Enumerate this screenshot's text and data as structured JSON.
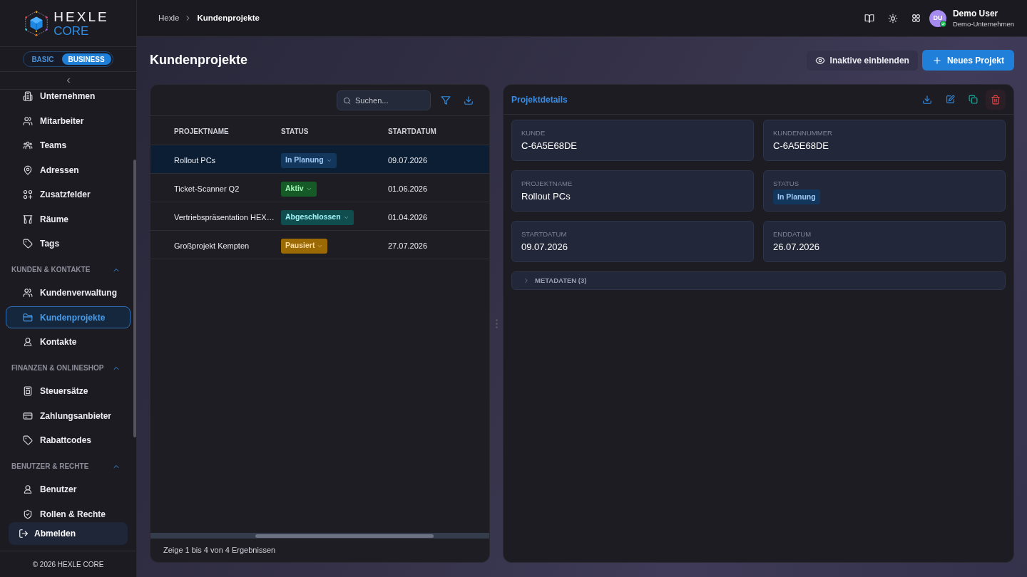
{
  "sidebar": {
    "logo": {
      "name": "HEXLE",
      "edition": "CORE"
    },
    "plans": [
      {
        "label": "BASIC",
        "selected": false
      },
      {
        "label": "BUSINESS",
        "selected": true
      }
    ],
    "groups": [
      {
        "items": [
          {
            "label": "Unternehmen",
            "selected": false
          },
          {
            "label": "Mitarbeiter",
            "selected": false
          },
          {
            "label": "Teams",
            "selected": false
          },
          {
            "label": "Adressen",
            "selected": false
          },
          {
            "label": "Zusatzfelder",
            "selected": false
          },
          {
            "label": "Räume",
            "selected": false
          },
          {
            "label": "Tags",
            "selected": false
          }
        ]
      },
      {
        "title": "KUNDEN & KONTAKTE",
        "expanded": true,
        "items": [
          {
            "label": "Kundenverwaltung",
            "selected": false
          },
          {
            "label": "Kundenprojekte",
            "selected": true
          },
          {
            "label": "Kontakte",
            "selected": false
          }
        ]
      },
      {
        "title": "FINANZEN & ONLINESHOP",
        "expanded": true,
        "items": [
          {
            "label": "Steuersätze",
            "selected": false
          },
          {
            "label": "Zahlungsanbieter",
            "selected": false
          },
          {
            "label": "Rabattcodes",
            "selected": false
          }
        ]
      },
      {
        "title": "BENUTZER & RECHTE",
        "expanded": true,
        "items": [
          {
            "label": "Benutzer",
            "selected": false
          },
          {
            "label": "Rollen & Rechte",
            "selected": false
          }
        ]
      }
    ],
    "logout": "Abmelden",
    "footer": "© 2026 HEXLE CORE"
  },
  "topbar": {
    "breadcrumb": [
      "Hexle",
      "Kundenprojekte"
    ],
    "user": {
      "initials": "DU",
      "name": "Demo User",
      "company": "Demo-Unternehmen"
    }
  },
  "page": {
    "title": "Kundenprojekte",
    "actions": [
      {
        "label": "Inaktive einblenden",
        "kind": "secondary"
      },
      {
        "label": "Neues Projekt",
        "kind": "primary"
      }
    ]
  },
  "table": {
    "search": {
      "placeholder": "Suchen..."
    },
    "columns": [
      "PROJEKTNAME",
      "STATUS",
      "STARTDATUM"
    ],
    "rows": [
      {
        "name": "Rollout PCs",
        "status": "In Planung",
        "color": "#12365c",
        "start": "09.07.2026",
        "selected": true
      },
      {
        "name": "Ticket-Scanner Q2",
        "status": "Aktiv",
        "color": "#165a27",
        "start": "01.06.2026",
        "selected": false
      },
      {
        "name": "Vertriebspräsentation HEX…",
        "status": "Abgeschlossen",
        "color": "#0f4d4f",
        "start": "01.04.2026",
        "selected": false
      },
      {
        "name": "Großprojekt Kempten",
        "status": "Pausiert",
        "color": "#9c6a04",
        "start": "27.07.2026",
        "selected": false
      }
    ],
    "footer": "Zeige 1 bis 4 von 4 Ergebnissen"
  },
  "details": {
    "title": "Projektdetails",
    "fields": [
      {
        "label": "KUNDE",
        "value": "C-6A5E68DE",
        "kind": "text"
      },
      {
        "label": "KUNDENNUMMER",
        "value": "C-6A5E68DE",
        "kind": "text"
      },
      {
        "label": "PROJEKTNAME",
        "value": "Rollout PCs",
        "kind": "text"
      },
      {
        "label": "STATUS",
        "value": "In Planung",
        "kind": "status",
        "color": "#12365c"
      },
      {
        "label": "STARTDATUM",
        "value": "09.07.2026",
        "kind": "text"
      },
      {
        "label": "ENDDATUM",
        "value": "26.07.2026",
        "kind": "text"
      }
    ],
    "metadata": {
      "label": "METADATEN (3)",
      "expanded": false
    }
  }
}
